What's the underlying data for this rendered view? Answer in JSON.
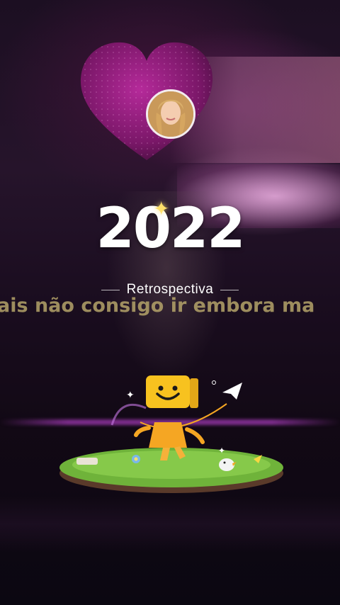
{
  "hero": {
    "year": "2022",
    "subtitle": "Retrospectiva"
  },
  "lyrics": {
    "caption": "ais não consigo ir embora ma"
  },
  "icons": {
    "heart": "heart-icon",
    "sparkle": "sparkle-icon",
    "mascot": "smiley-box-mascot-icon",
    "paper_plane": "paper-plane-icon",
    "bird": "bird-icon"
  },
  "colors": {
    "heart": "#8a1a74",
    "year_text": "#ffffff",
    "sparkle": "#ffe06b",
    "caption": "#b5a46a",
    "mascot": "#f5a623",
    "grass": "#6fb33a"
  }
}
